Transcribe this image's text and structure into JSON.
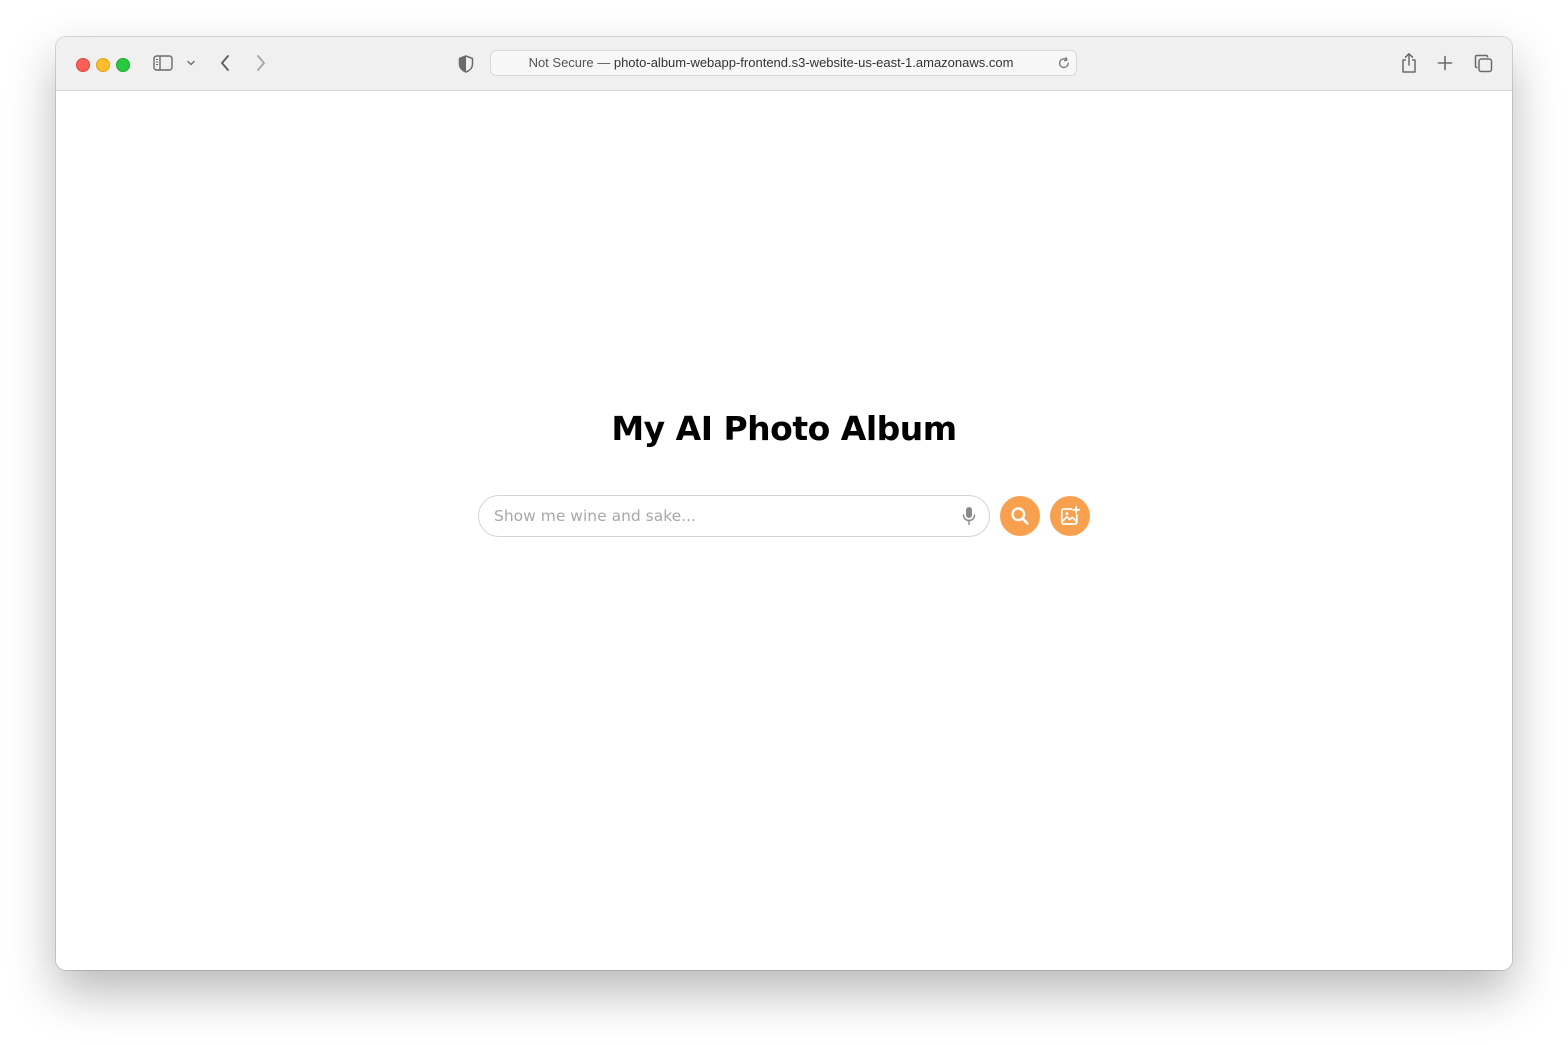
{
  "browser": {
    "address_prefix": "Not Secure —",
    "address_host": "photo-album-webapp-frontend.s3-website-us-east-1.amazonaws.com",
    "icons": [
      "sidebar-icon",
      "chevron-down-icon",
      "back-icon",
      "forward-icon",
      "privacy-shield-icon",
      "reload-icon",
      "share-icon",
      "new-tab-icon",
      "tab-overview-icon"
    ]
  },
  "page": {
    "title": "My AI Photo Album",
    "search": {
      "placeholder": "Show me wine and sake...",
      "value": ""
    },
    "buttons": {
      "search_icon": "search-icon",
      "upload_icon": "add-photo-icon"
    }
  },
  "colors": {
    "accent": "#f9a04e",
    "title": "#000000",
    "placeholder": "#a8a8a8"
  }
}
